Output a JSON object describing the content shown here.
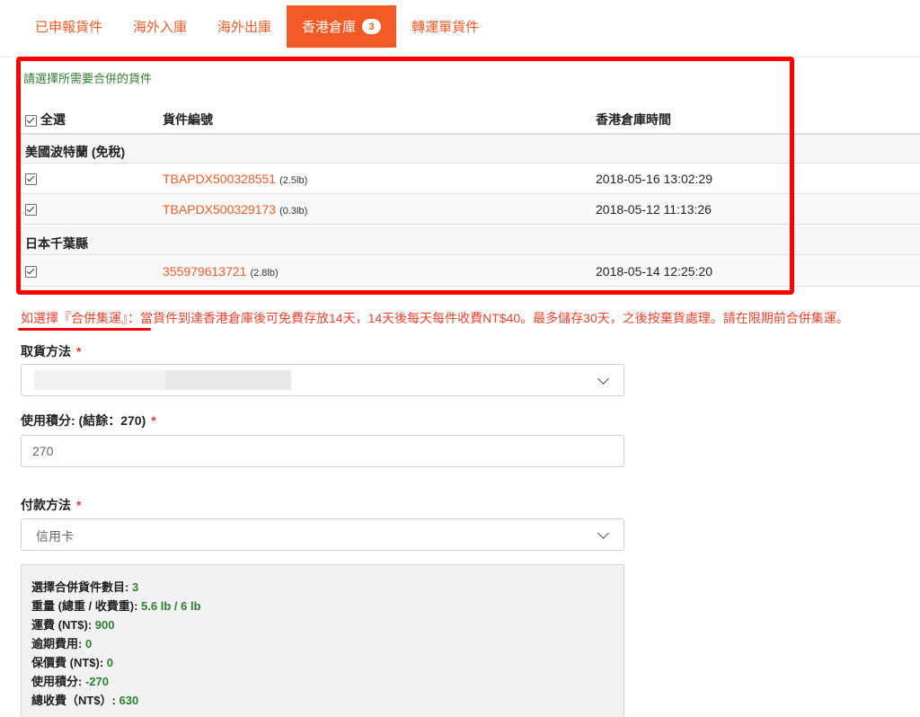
{
  "tabs": [
    {
      "label": "已申報貨件"
    },
    {
      "label": "海外入庫"
    },
    {
      "label": "海外出庫"
    },
    {
      "label": "香港倉庫",
      "badge": "3"
    },
    {
      "label": "轉運單貨件"
    }
  ],
  "merge_table": {
    "heading": "請選擇所需要合併的貨件",
    "select_all_label": "全選",
    "columns": {
      "tracking": "貨件編號",
      "time": "香港倉庫時間"
    },
    "groups": [
      {
        "name": "美國波特蘭 (免稅)",
        "rows": [
          {
            "tracking": "TBAPDX500328551",
            "weight": "(2.5lb)",
            "time": "2018-05-16 13:02:29"
          },
          {
            "tracking": "TBAPDX500329173",
            "weight": "(0.3lb)",
            "time": "2018-05-12 11:13:26"
          }
        ]
      },
      {
        "name": "日本千葉縣",
        "rows": [
          {
            "tracking": "355979613721",
            "weight": "(2.8lb)",
            "time": "2018-05-14 12:25:20"
          }
        ]
      }
    ]
  },
  "notice": "如選擇『合併集運』：當貨件到達香港倉庫後可免費存放14天，14天後每天每件收費NT$40。最多儲存30天，之後按棄貨處理。請在限期前合併集運。",
  "pickup": {
    "label": "取貨方法",
    "required": "*"
  },
  "points": {
    "label": "使用積分: (結餘：270)",
    "required": "*",
    "value": "270"
  },
  "payment": {
    "label": "付款方法",
    "required": "*",
    "value": "信用卡"
  },
  "summary": [
    {
      "label": "選擇合併貨件數目: ",
      "value": "3"
    },
    {
      "label": "重量 (總重 / 收費重): ",
      "value": "5.6 lb / 6 lb"
    },
    {
      "label": "運費 (NT$): ",
      "value": "900"
    },
    {
      "label": "逾期費用: ",
      "value": "0"
    },
    {
      "label": "保價費 (NT$): ",
      "value": "0"
    },
    {
      "label": "使用積分: ",
      "value": "-270"
    },
    {
      "label": "總收費（NT$）: ",
      "value": "630"
    }
  ],
  "colors": {
    "accent": "#f15a24",
    "heading_green": "#2e7d32",
    "notice_red": "#e8442e",
    "annotation_red": "#ff0000"
  }
}
